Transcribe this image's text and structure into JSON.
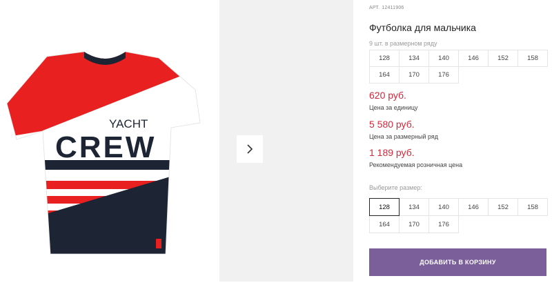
{
  "product": {
    "sku_label": "АРТ.",
    "sku": "12411906",
    "title": "Футболка для мальчика",
    "image": {
      "graphic_line1": "YACHT",
      "graphic_line2": "CREW"
    }
  },
  "size_row": {
    "caption": "9 шт. в размерном ряду",
    "sizes": [
      "128",
      "134",
      "140",
      "146",
      "152",
      "158",
      "164",
      "170",
      "176"
    ]
  },
  "prices": {
    "unit": {
      "value": "620 руб.",
      "label": "Цена за единицу"
    },
    "row": {
      "value": "5 580 руб.",
      "label": "Цена за размерный ряд"
    },
    "retail": {
      "value": "1 189 руб.",
      "label": "Рекомендуемая розничная цена"
    }
  },
  "size_picker": {
    "label": "Выберите размер:",
    "selected": "128",
    "sizes": [
      "128",
      "134",
      "140",
      "146",
      "152",
      "158",
      "164",
      "170",
      "176"
    ]
  },
  "cart": {
    "button_label": "ДОБАВИТЬ В КОРЗИНУ"
  },
  "colors": {
    "accent": "#7a5f9a",
    "price": "#d0293b",
    "shirt_red": "#e8201f",
    "shirt_navy": "#1d2433"
  }
}
